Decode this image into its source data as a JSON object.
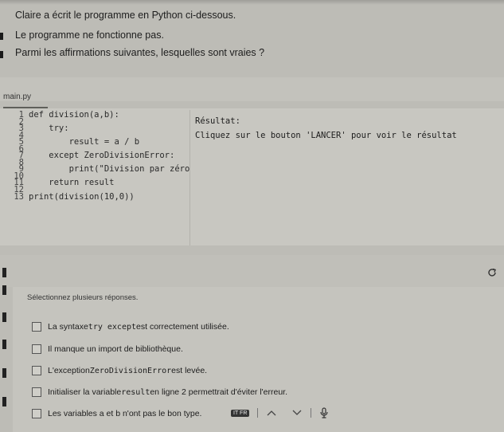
{
  "question": {
    "line1": "Claire a écrit le programme en Python ci-dessous.",
    "line2": "Le programme ne fonctionne pas.",
    "line3": "Parmi les affirmations suivantes, lesquelles sont vraies ?"
  },
  "editor": {
    "tab_label": "main.py",
    "lines": [
      {
        "n": "1",
        "code": "def division(a,b):"
      },
      {
        "n": "2",
        "code": ""
      },
      {
        "n": "3",
        "code": "    try:"
      },
      {
        "n": "4",
        "code": ""
      },
      {
        "n": "5",
        "code": "        result = a / b"
      },
      {
        "n": "6",
        "code": ""
      },
      {
        "n": "7",
        "code": "    except ZeroDivisionError:"
      },
      {
        "n": "8",
        "code": ""
      },
      {
        "n": "9",
        "code": "        print(\"Division par zéro"
      },
      {
        "n": "10",
        "code": ""
      },
      {
        "n": "11",
        "code": "    return result"
      },
      {
        "n": "12",
        "code": ""
      },
      {
        "n": "13",
        "code": "print(division(10,0))"
      }
    ],
    "result_title": "Résultat:",
    "result_text": "Cliquez sur le bouton 'LANCER' pour voir le résultat"
  },
  "answers": {
    "instruction": "Sélectionnez plusieurs réponses.",
    "options": [
      {
        "pre": "La syntaxe ",
        "code": "try except",
        "post": " est correctement utilisée."
      },
      {
        "pre": "Il manque un import de bibliothèque.",
        "code": "",
        "post": ""
      },
      {
        "pre": "L'exception ",
        "code": "ZeroDivisionError",
        "post": " est levée."
      },
      {
        "pre": "Initialiser la variable ",
        "code": "result",
        "post": " en ligne 2 permettrait d'éviter l'erreur."
      },
      {
        "pre": "Les variables a et b n'ont pas le bon type.",
        "code": "",
        "post": ""
      }
    ]
  },
  "toolbar": {
    "flag": "IT FR",
    "icons": [
      "chevron-up-icon",
      "chevron-down-icon",
      "microphone-icon"
    ]
  },
  "icons": {
    "reload": "reload-icon"
  }
}
